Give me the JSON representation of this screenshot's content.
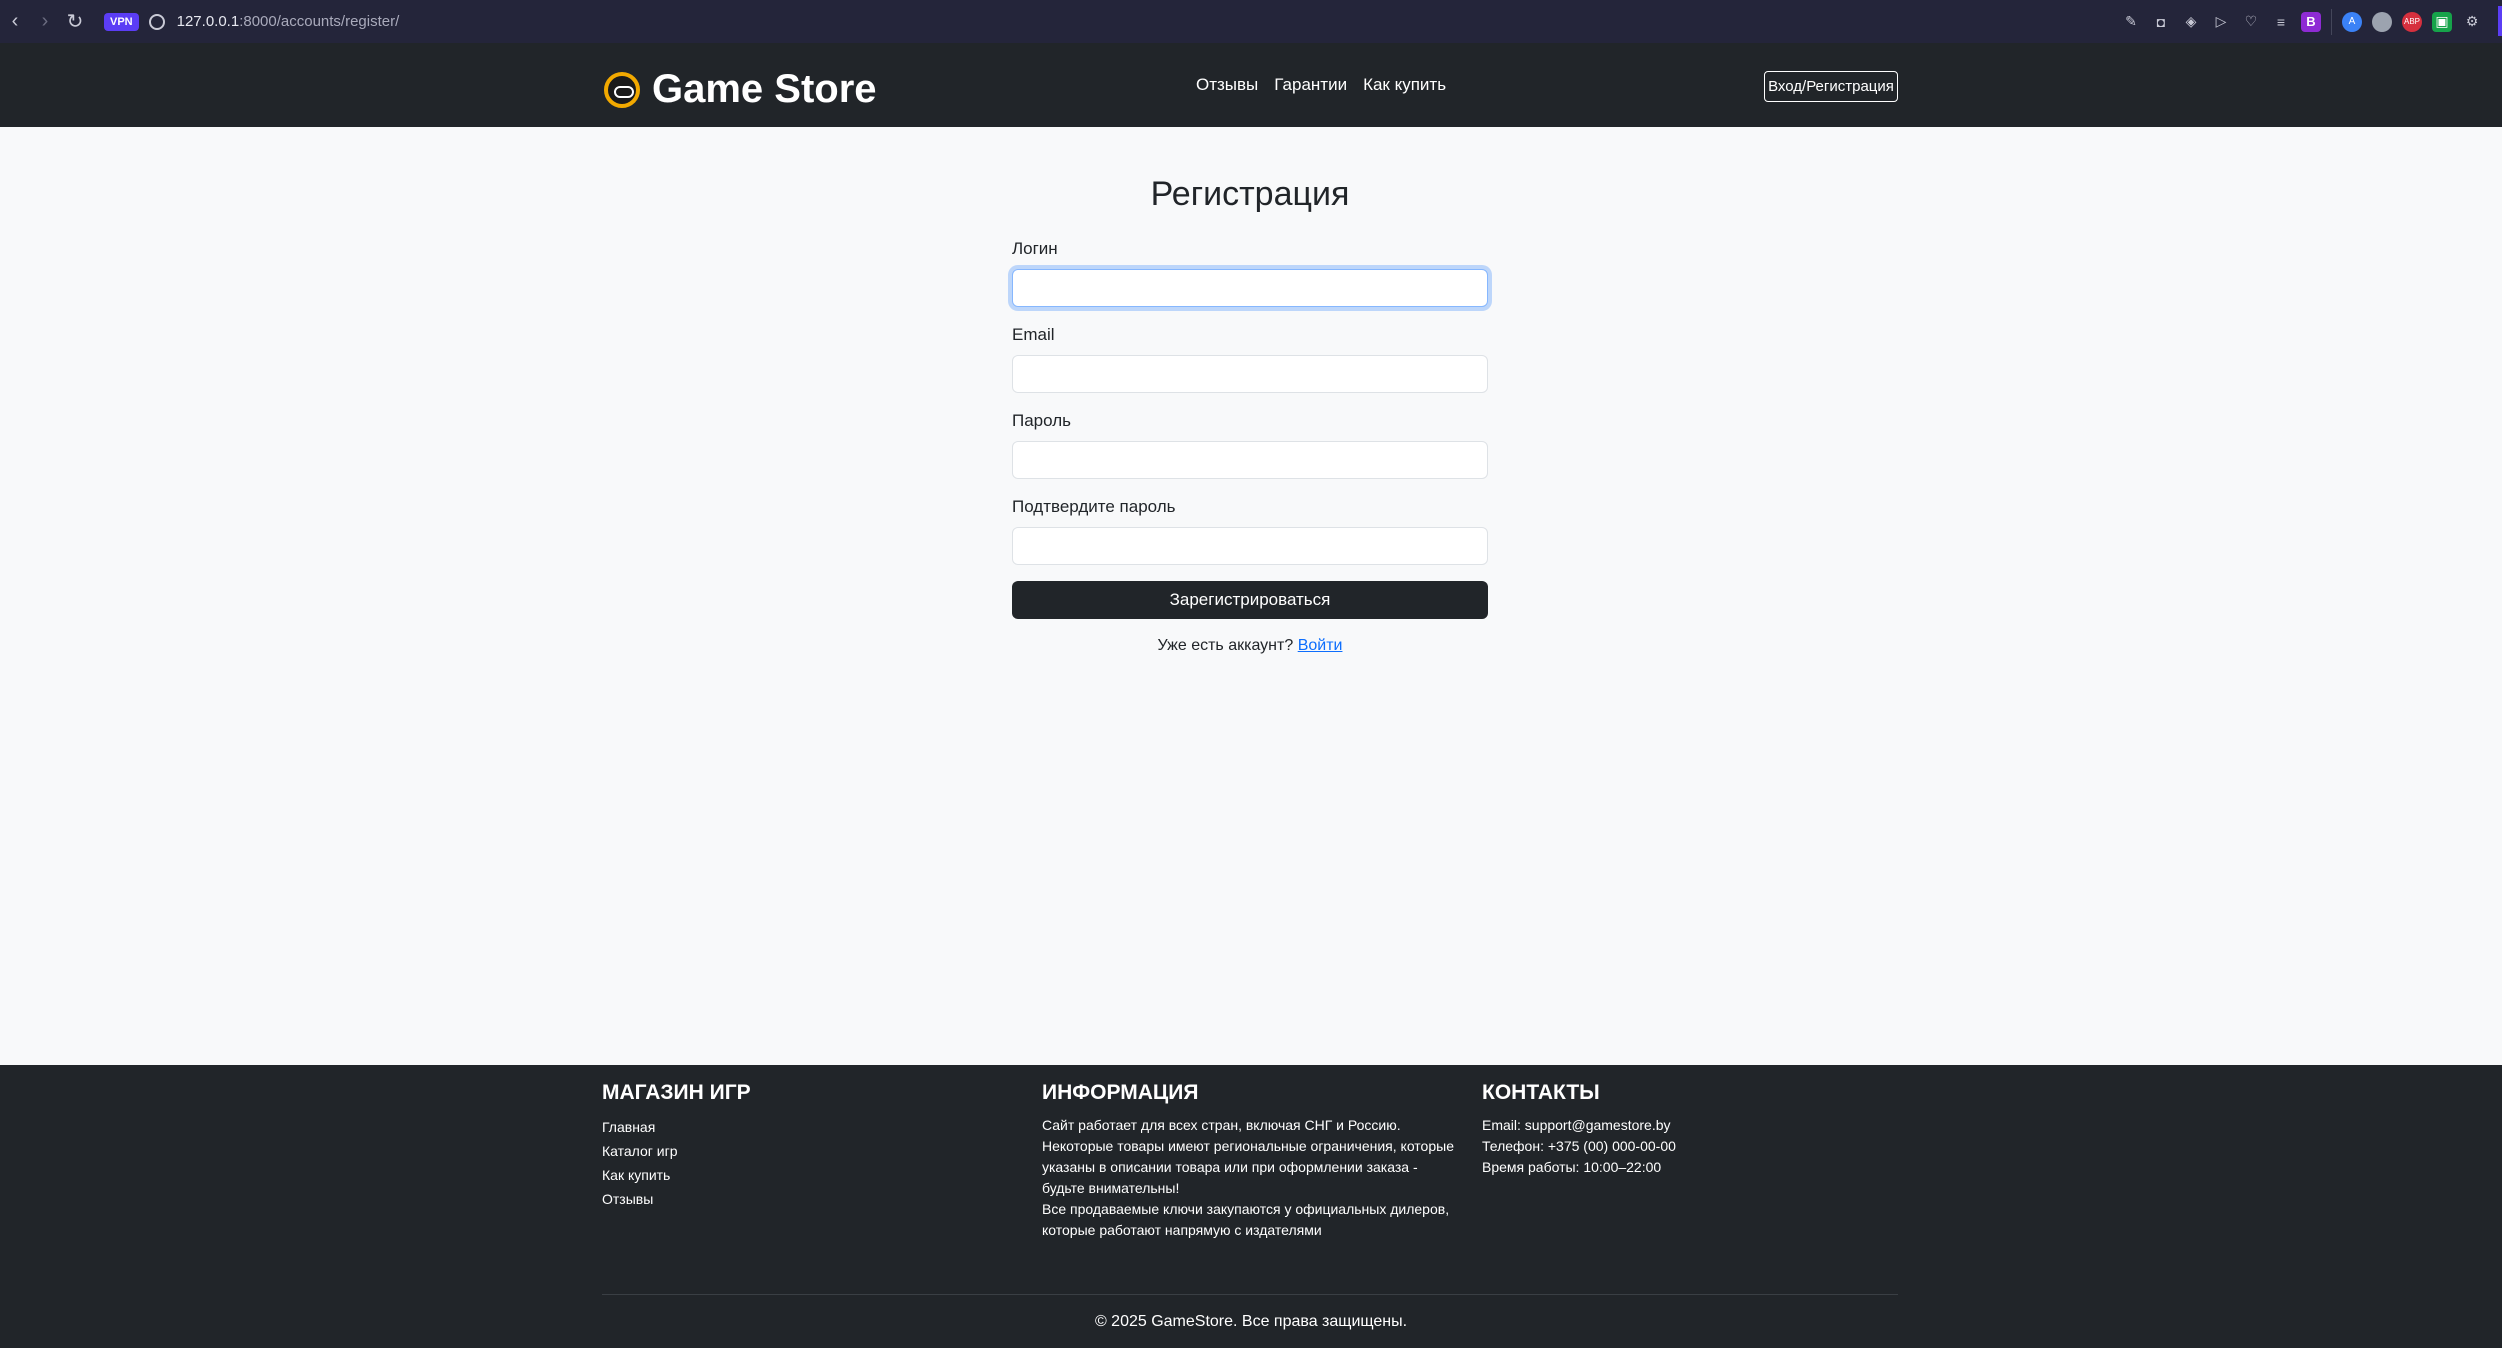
{
  "browser": {
    "url_host": "127.0.0.1",
    "url_path": ":8000/accounts/register/",
    "vpn_label": "VPN",
    "profile_badge": "B",
    "abp_badge": "ABP"
  },
  "header": {
    "logo_text": "Game Store",
    "nav": [
      "Отзывы",
      "Гарантии",
      "Как купить"
    ],
    "login_button": "Вход/Регистрация"
  },
  "form": {
    "title": "Регистрация",
    "fields": [
      {
        "label": "Логин",
        "value": ""
      },
      {
        "label": "Email",
        "value": ""
      },
      {
        "label": "Пароль",
        "value": ""
      },
      {
        "label": "Подтвердите пароль",
        "value": ""
      }
    ],
    "submit_label": "Зарегистрироваться",
    "have_account_text": "Уже есть аккаунт?",
    "login_link": "Войти"
  },
  "footer": {
    "col1": {
      "title": "МАГАЗИН ИГР",
      "links": [
        "Главная",
        "Каталог игр",
        "Как купить",
        "Отзывы"
      ]
    },
    "col2": {
      "title": "ИНФОРМАЦИЯ",
      "text1": "Сайт работает для всех стран, включая СНГ и Россию.",
      "text2": "Некоторые товары имеют региональные ограничения, которые указаны в описании товара или при оформлении заказа - будьте внимательны!",
      "text3": "Все продаваемые ключи закупаются у официальных дилеров, которые работают напрямую с издателями"
    },
    "col3": {
      "title": "КОНТАКТЫ",
      "email": "Email: support@gamestore.by",
      "phone": "Телефон: +375 (00) 000-00-00",
      "hours": "Время работы: 10:00–22:00"
    },
    "copyright": "© 2025 GameStore. Все права защищены."
  }
}
